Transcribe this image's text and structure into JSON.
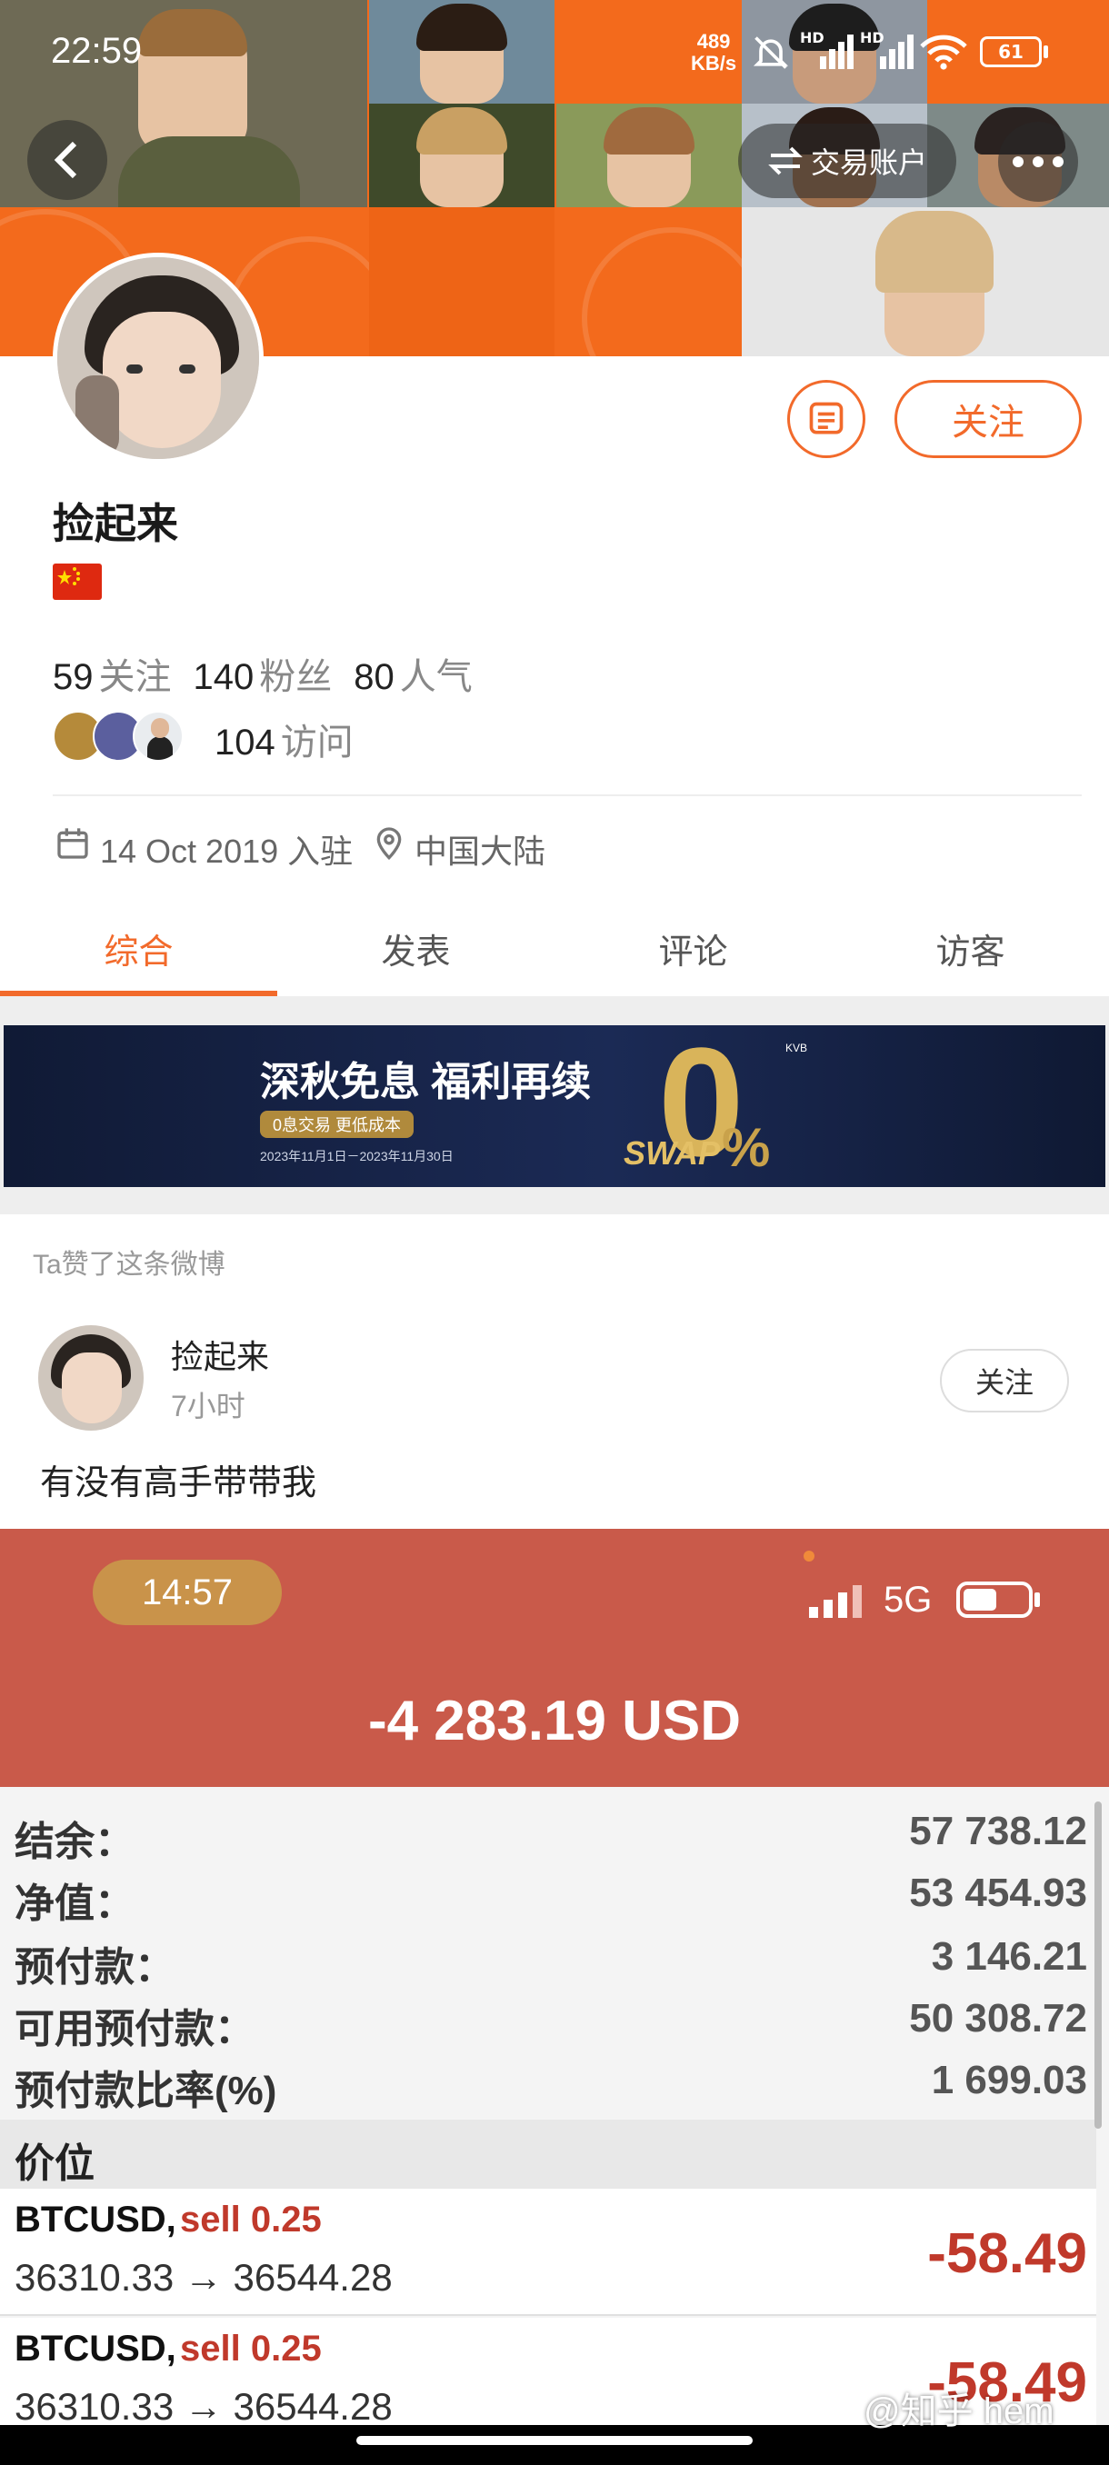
{
  "status_bar": {
    "time": "22:59",
    "net_speed_top": "489",
    "net_speed_bottom": "KB/s",
    "hd1": "HD",
    "hd2": "HD",
    "battery": "61"
  },
  "header": {
    "trade_account_label": "交易账户"
  },
  "profile": {
    "name": "捡起来",
    "follow_button": "关注",
    "stats": [
      {
        "value": "59",
        "label": "关注"
      },
      {
        "value": "140",
        "label": "粉丝"
      },
      {
        "value": "80",
        "label": "人气"
      }
    ],
    "visits_value": "104",
    "visits_label": "访问",
    "joined": "14 Oct 2019 入驻",
    "location": "中国大陆"
  },
  "tabs": [
    "综合",
    "发表",
    "评论",
    "访客"
  ],
  "ad": {
    "title": "深秋免息 福利再续",
    "tag": "0息交易 更低成本",
    "date": "2023年11月1日－2023年11月30日",
    "logo": "KVB",
    "swap": "SWAP",
    "zero": "0",
    "percent": "%"
  },
  "feed": {
    "liked_label": "Ta赞了这条微博",
    "author": "捡起来",
    "time": "7小时",
    "follow": "关注",
    "content": "有没有高手带带我"
  },
  "screenshot": {
    "time": "14:57",
    "network": "5G",
    "pnl": "-4 283.19 USD",
    "rows": [
      {
        "label": "结余：",
        "value": "57 738.12"
      },
      {
        "label": "净值：",
        "value": "53 454.93"
      },
      {
        "label": "预付款：",
        "value": "3 146.21"
      },
      {
        "label": "可用预付款：",
        "value": "50 308.72"
      },
      {
        "label": "预付款比率(%)",
        "value": "1 699.03"
      }
    ],
    "section": "价位",
    "positions": [
      {
        "symbol": "BTCUSD,",
        "side": "sell 0.25",
        "prices": "36310.33 → 36544.28",
        "profit": "-58.49"
      },
      {
        "symbol": "BTCUSD,",
        "side": "sell 0.25",
        "prices": "36310.33 → 36544.28",
        "profit": "-58.49"
      }
    ]
  },
  "watermark": "@知乎 hem",
  "colors": {
    "accent": "#f26a2b",
    "banner": "#f36a1c",
    "red_panel": "#c95a4a",
    "loss": "#c0392b"
  }
}
